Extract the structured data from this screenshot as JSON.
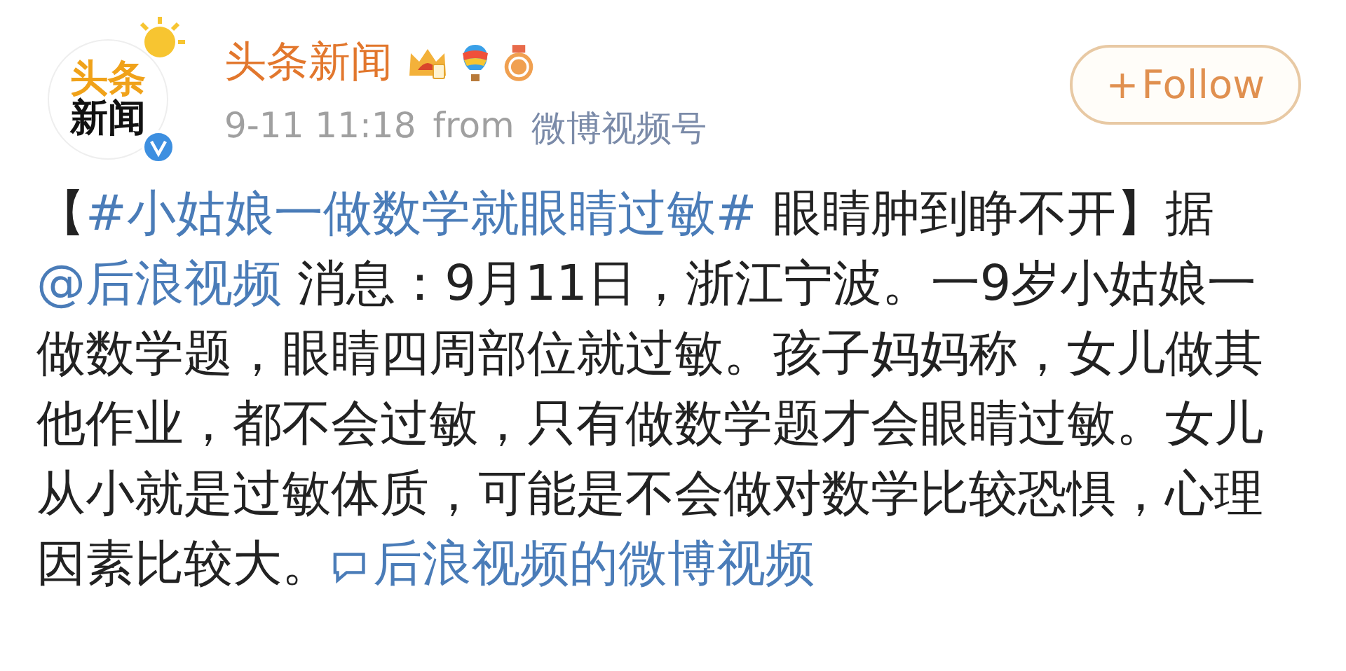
{
  "avatar": {
    "logo_top": "头条",
    "logo_bottom": "新闻",
    "verified": true
  },
  "account": {
    "name": "头条新闻",
    "time": "9-11 11:18",
    "source_prefix": "from",
    "source": "微博视频号"
  },
  "follow_button": {
    "plus": "+",
    "label": "Follow"
  },
  "post": [
    {
      "kind": "text",
      "text": "【"
    },
    {
      "kind": "hashtag",
      "text": "#小姑娘一做数学就眼睛过敏#"
    },
    {
      "kind": "text",
      "text": " 眼睛肿到睁不开】据"
    },
    {
      "kind": "mention",
      "text": "@后浪视频"
    },
    {
      "kind": "text",
      "text": " 消息：9月11日，浙江宁波。一9岁小姑娘一做数学题，眼睛四周部位就过敏。孩子妈妈称，女儿做其他作业，都不会过敏，只有做数学题才会眼睛过敏。女儿从小就是过敏体质，可能是不会做对数学比较恐惧，心理因素比较大。"
    },
    {
      "kind": "video_link",
      "text": "后浪视频的微博视频"
    }
  ]
}
